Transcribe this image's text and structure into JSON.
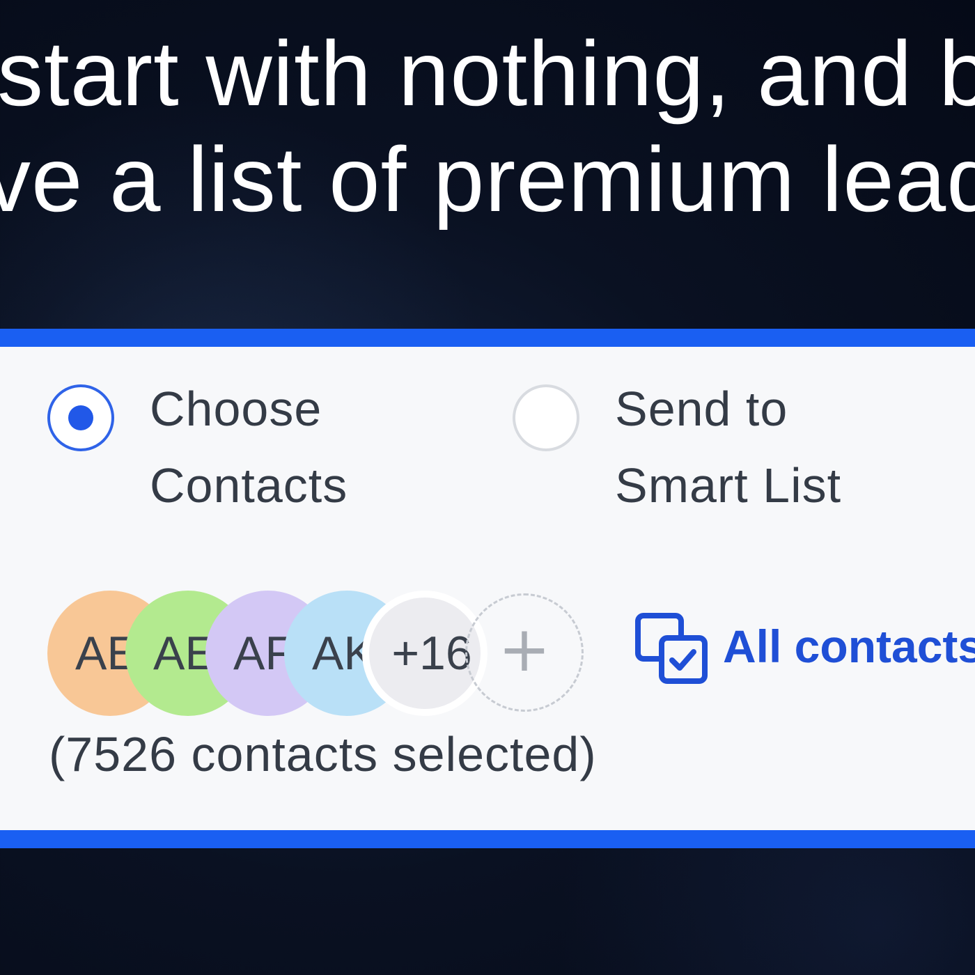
{
  "headline": {
    "line1": "start with nothing, and by",
    "line2": "ve a list of premium leads"
  },
  "recipient_mode": {
    "options": [
      {
        "label": "Choose\nContacts",
        "selected": true
      },
      {
        "label": "Send to\nSmart List",
        "selected": false
      }
    ]
  },
  "contacts": {
    "avatars": [
      {
        "initials": "AE",
        "color": "#f8c796"
      },
      {
        "initials": "AE",
        "color": "#b3ea8f"
      },
      {
        "initials": "AF",
        "color": "#d3c8f5"
      },
      {
        "initials": "AK",
        "color": "#b9e0f7"
      }
    ],
    "more_count": "+16",
    "add_symbol": "+",
    "all_contacts_label": "All contacts",
    "selected_count_text": "(7526 contacts selected)"
  },
  "colors": {
    "accent": "#1a5ff2",
    "link": "#1f4fd6",
    "background": "#0a1122"
  }
}
